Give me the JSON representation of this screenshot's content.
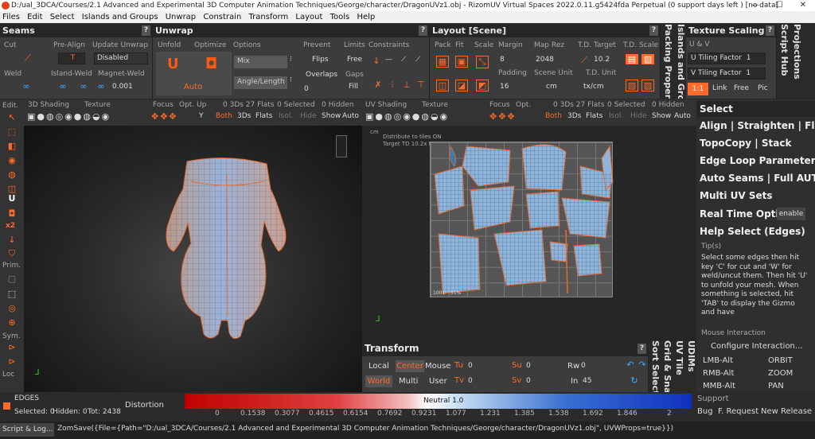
{
  "window": {
    "title": "D:/ual_3DCA/Courses/2.1 Advanced and Experimental 3D Computer Animation Techniques/George/character/DragonUVz1.obj - RizomUV  Virtual Spaces 2022.0.11.g5424fda Perpetual  (0 support days left ) [no data]"
  },
  "menu": [
    "Files",
    "Edit",
    "Select",
    "Islands and Groups",
    "Unwrap",
    "Constrain",
    "Transform",
    "Layout",
    "Tools",
    "Help"
  ],
  "seams": {
    "title": "Seams",
    "cut": "Cut",
    "pre_align": "Pre-Align",
    "update_unwrap": "Update Unwrap",
    "pre_align_val": "T",
    "update_val": "Disabled",
    "weld": "Weld",
    "island_weld": "Island-Weld",
    "magnet_weld": "Magnet-Weld",
    "magnet_val": "0.001"
  },
  "unwrap": {
    "title": "Unwrap",
    "unfold": "Unfold",
    "optimize": "Optimize",
    "options": "Options",
    "mix": "Mix",
    "angle_length": "Angle/Length",
    "auto": "Auto",
    "prevent": "Prevent",
    "flips": "Flips",
    "overlaps": "Overlaps",
    "overlaps_val": "0",
    "limits": "Limits",
    "free": "Free",
    "gaps": "Gaps",
    "fill": "Fill",
    "constraints": "Constraints"
  },
  "layout": {
    "title": "Layout [Scene]",
    "pack": "Pack",
    "fit": "Fit",
    "scale": "Scale",
    "margin": "Margin",
    "margin_val": "8",
    "padding": "Padding",
    "padding_val": "16",
    "map_rez": "Map Rez",
    "map_rez_val": "2048",
    "scene_unit": "Scene Unit",
    "scene_unit_val": "cm",
    "td_target": "T.D. Target",
    "td_target_val": "10.2",
    "td_unit": "T.D. Unit",
    "td_unit_val": "tx/cm",
    "td_scale": "T.D. Scale"
  },
  "vtabs": {
    "islands": "Islands and Groups",
    "packing": "Packing Properties",
    "script_hub": "Script Hub",
    "projections": "Projections",
    "udims": "UDIMs",
    "uv_tile": "UV Tile",
    "grid_snap": "Grid & Snap",
    "sort_select": "Sort Select"
  },
  "texture_scaling": {
    "title": "Texture Scaling",
    "uv": "U & V",
    "u_tiling": "U Tiling Factor",
    "u_val": "1",
    "v_tiling": "V Tiling Factor",
    "v_val": "1",
    "ratio": "1:1",
    "link": "Link",
    "free": "Free",
    "pic": "Pic"
  },
  "left_tools": {
    "edit": "Edit.",
    "prim": "Prim.",
    "sym": "Sym.",
    "loc": "Loc",
    "x2": "x2"
  },
  "view3d": {
    "shading": "3D Shading",
    "texture": "Texture",
    "focus": "Focus",
    "opt_up": "Opt. Up",
    "flats_count": "0 3Ds 27 Flats",
    "selected": "0 Selected",
    "hidden": "0 Hidden",
    "axis": "Y",
    "both": "Both",
    "threeds": "3Ds",
    "flats": "Flats",
    "isol": "Isol.",
    "hide": "Hide",
    "show": "Show",
    "auto": "Auto"
  },
  "viewuv": {
    "shading": "UV Shading",
    "texture": "Texture",
    "focus": "Focus",
    "opt": "Opt.",
    "flats_count": "0 3Ds 27 Flats",
    "selected": "0 Selected",
    "hidden": "0 Hidden",
    "both": "Both",
    "threeds": "3Ds",
    "flats": "Flats",
    "isol": "Isol.",
    "hide": "Hide",
    "show": "Show",
    "auto": "Auto",
    "info1": "Distribute to tiles ON",
    "info2": "Target TD 10.2x tx/cm",
    "tile": "1001",
    "pct": "51%",
    "cm": "cm"
  },
  "transform": {
    "title": "Transform",
    "local": "Local",
    "center": "Center",
    "mouse": "Mouse",
    "world": "World",
    "multi": "Multi",
    "user": "User",
    "tu": "Tu",
    "tu_val": "0",
    "tv": "Tv",
    "tv_val": "0",
    "su": "Su",
    "su_val": "0",
    "sv": "Sv",
    "sv_val": "0",
    "rw": "Rw",
    "rw_val": "0",
    "in": "In",
    "in_val": "45"
  },
  "right_panel": {
    "select": "Select",
    "align": "Align | Straighten | Flip",
    "topocopy": "TopoCopy | Stack",
    "edge_loop": "Edge Loop Parameters",
    "auto_seams": "Auto Seams | Full AUTO",
    "multi_uv": "Multi UV Sets",
    "real_time": "Real Time Optimize",
    "enable": "enable",
    "help_select": "Help Select (Edges)",
    "tips": "Tip(s)",
    "tip_text": "Select some edges then hit key 'C' for cut and 'W' for weld/uncut them. Then hit 'U' to unfold your mesh. When something is selected, hit 'TAB' to display the Gizmo and have",
    "mouse_interaction": "Mouse Interaction",
    "configure": "Configure Interaction...",
    "lmb": "LMB-Alt",
    "lmb_v": "ORBIT",
    "rmb": "RMB-Alt",
    "rmb_v": "ZOOM",
    "mmb": "MMB-Alt",
    "mmb_v": "PAN"
  },
  "status": {
    "mode": "EDGES",
    "selected": "Selected: 0",
    "hidden": "Hidden: 0",
    "tot": "Tot: 2438",
    "distortion": "Distortion",
    "neutral": "Neutral 1.0",
    "ticks": [
      "0",
      "0.1538",
      "0.3077",
      "0.4615",
      "0.6154",
      "0.7692",
      "0.9231",
      "1.077",
      "1.231",
      "1.385",
      "1.538",
      "1.692",
      "1.846",
      "2"
    ],
    "support": "Support",
    "bug": "Bug",
    "feature": "F. Request",
    "new_release": "New Release"
  },
  "console": {
    "label": "Script & Log...",
    "text": "ZomSave({File={Path=\"D:/ual_3DCA/Courses/2.1 Advanced and Experimental 3D Computer Animation Techniques/George/character/DragonUVz1.obj\", UVWProps=true}})"
  },
  "colors": {
    "accent": "#ff6a2a",
    "blue": "#3a8fd8"
  }
}
